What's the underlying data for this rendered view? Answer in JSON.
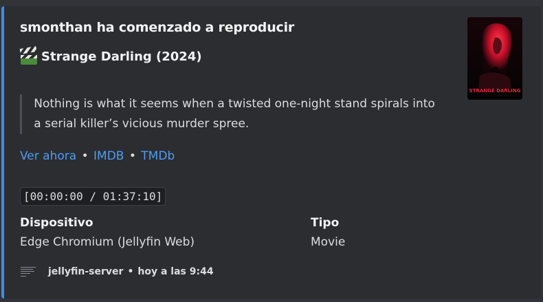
{
  "embed": {
    "accent_color": "#3c8de8",
    "title": "smonthan ha comenzado a reproducir",
    "movie_icon": "clapper-board-icon",
    "movie": "Strange Darling (2024)",
    "description": "Nothing is what it seems when a twisted one-night stand spirals into a serial killer’s vicious murder spree.",
    "links": {
      "watch_now": "Ver ahora",
      "separator": "•",
      "imdb": "IMDB",
      "tmdb": "TMDb"
    },
    "progress": "[00:00:00 / 01:37:10]",
    "fields": [
      {
        "name": "Dispositivo",
        "value": "Edge Chromium (Jellyfin Web)"
      },
      {
        "name": "Tipo",
        "value": "Movie"
      }
    ],
    "footer": {
      "server": "jellyfin-server",
      "separator": "•",
      "time": "hoy a las 9:44"
    },
    "poster": {
      "title_text": "STRANGE DARLING"
    }
  }
}
